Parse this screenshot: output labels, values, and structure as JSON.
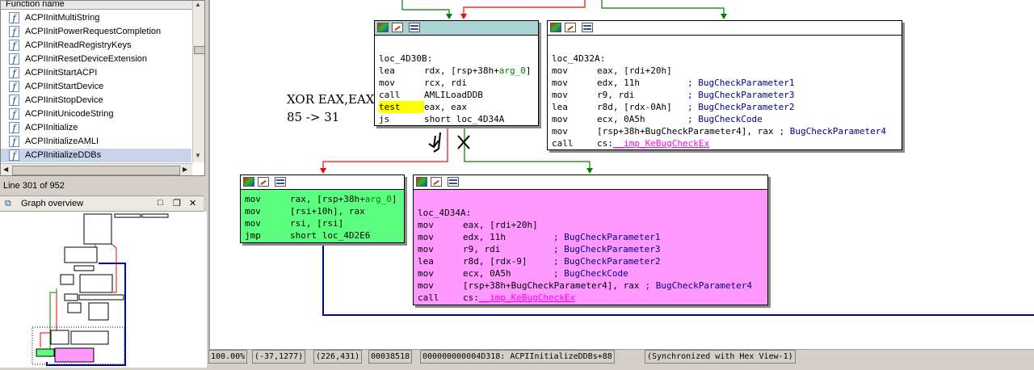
{
  "function_list": {
    "header": "Function name",
    "items": [
      {
        "icon": "f",
        "label": "ACPIInitMultiString"
      },
      {
        "icon": "f",
        "label": "ACPIInitPowerRequestCompletion"
      },
      {
        "icon": "f",
        "label": "ACPIInitReadRegistryKeys"
      },
      {
        "icon": "f",
        "label": "ACPIInitResetDeviceExtension"
      },
      {
        "icon": "f",
        "label": "ACPIInitStartACPI"
      },
      {
        "icon": "f",
        "label": "ACPIInitStartDevice"
      },
      {
        "icon": "f",
        "label": "ACPIInitStopDevice"
      },
      {
        "icon": "f",
        "label": "ACPIInitUnicodeString"
      },
      {
        "icon": "f",
        "label": "ACPIInitialize"
      },
      {
        "icon": "f",
        "label": "ACPIInitializeAMLI"
      },
      {
        "icon": "f",
        "label": "ACPIInitializeDDBs"
      }
    ],
    "selected_index": 10,
    "line_info": "Line 301 of 952"
  },
  "graph_overview": {
    "title": "Graph overview",
    "icon": "graph-overview-icon"
  },
  "annotations": {
    "line1": "XOR EAX,EAX",
    "line2": "85 -> 31"
  },
  "blocks": {
    "b1": {
      "label": "loc_4D30B:",
      "rows": [
        {
          "mn": "lea",
          "op": "rdx, [rsp+38h+",
          "op2": "arg_0",
          "op3": "]"
        },
        {
          "mn": "mov",
          "op": "rcx, rdi"
        },
        {
          "mn": "call",
          "op": "AMLILoadDDB"
        },
        {
          "mn": "test",
          "op": "eax, eax"
        },
        {
          "mn": "js",
          "op": "short loc_4D34A"
        }
      ]
    },
    "b2": {
      "label": "loc_4D32A:",
      "rows": [
        {
          "mn": "mov",
          "op": "eax, [rdi+20h]",
          "cm": ""
        },
        {
          "mn": "mov",
          "op": "edx, 11h",
          "cm": "; BugCheckParameter1"
        },
        {
          "mn": "mov",
          "op": "r9, rdi",
          "cm": "; BugCheckParameter3"
        },
        {
          "mn": "lea",
          "op": "r8d, [rdx-0Ah]",
          "cm": "; BugCheckParameter2"
        },
        {
          "mn": "mov",
          "op": "ecx, 0A5h",
          "cm": "; BugCheckCode"
        },
        {
          "mn": "mov",
          "op": "[rsp+38h+BugCheckParameter4], rax",
          "cm": "; BugCheckParameter4"
        },
        {
          "mn": "call",
          "op": "cs:",
          "imp": "__imp_KeBugCheckEx"
        }
      ]
    },
    "b3": {
      "rows": [
        {
          "mn": "mov",
          "op": "rax, [rsp+38h+",
          "op2": "arg_0",
          "op3": "]"
        },
        {
          "mn": "mov",
          "op": "[rsi+10h], rax"
        },
        {
          "mn": "mov",
          "op": "rsi, [rsi]"
        },
        {
          "mn": "jmp",
          "op": "short loc_4D2E6"
        }
      ]
    },
    "b4": {
      "label": "loc_4D34A:",
      "rows": [
        {
          "mn": "mov",
          "op": "eax, [rdi+20h]",
          "cm": ""
        },
        {
          "mn": "mov",
          "op": "edx, 11h",
          "cm": "; BugCheckParameter1"
        },
        {
          "mn": "mov",
          "op": "r9, rdi",
          "cm": "; BugCheckParameter3"
        },
        {
          "mn": "lea",
          "op": "r8d, [rdx-9]",
          "cm": "; BugCheckParameter2"
        },
        {
          "mn": "mov",
          "op": "ecx, 0A5h",
          "cm": "; BugCheckCode"
        },
        {
          "mn": "mov",
          "op": "[rsp+38h+BugCheckParameter4], rax",
          "cm": "; BugCheckParameter4"
        },
        {
          "mn": "call",
          "op": "cs:",
          "imp": "__imp_KeBugCheckEx"
        }
      ]
    }
  },
  "status_bar": {
    "zoom": "100.00%",
    "mouse_pos": "(-37,1277)",
    "graph_pos": "(226,431)",
    "offset": "00038518",
    "address": "000000000004D318: ACPIInitializeDDBs+88",
    "sync": "(Synchronized with Hex View-1)"
  },
  "colors": {
    "block_header_active": "#a9d4d4",
    "block_green": "#5cff80",
    "block_pink": "#ff99ff",
    "edge_red": "#ff0000",
    "edge_green": "#008000",
    "edge_blue": "#0000c0",
    "test_highlight": "#ffff00"
  }
}
